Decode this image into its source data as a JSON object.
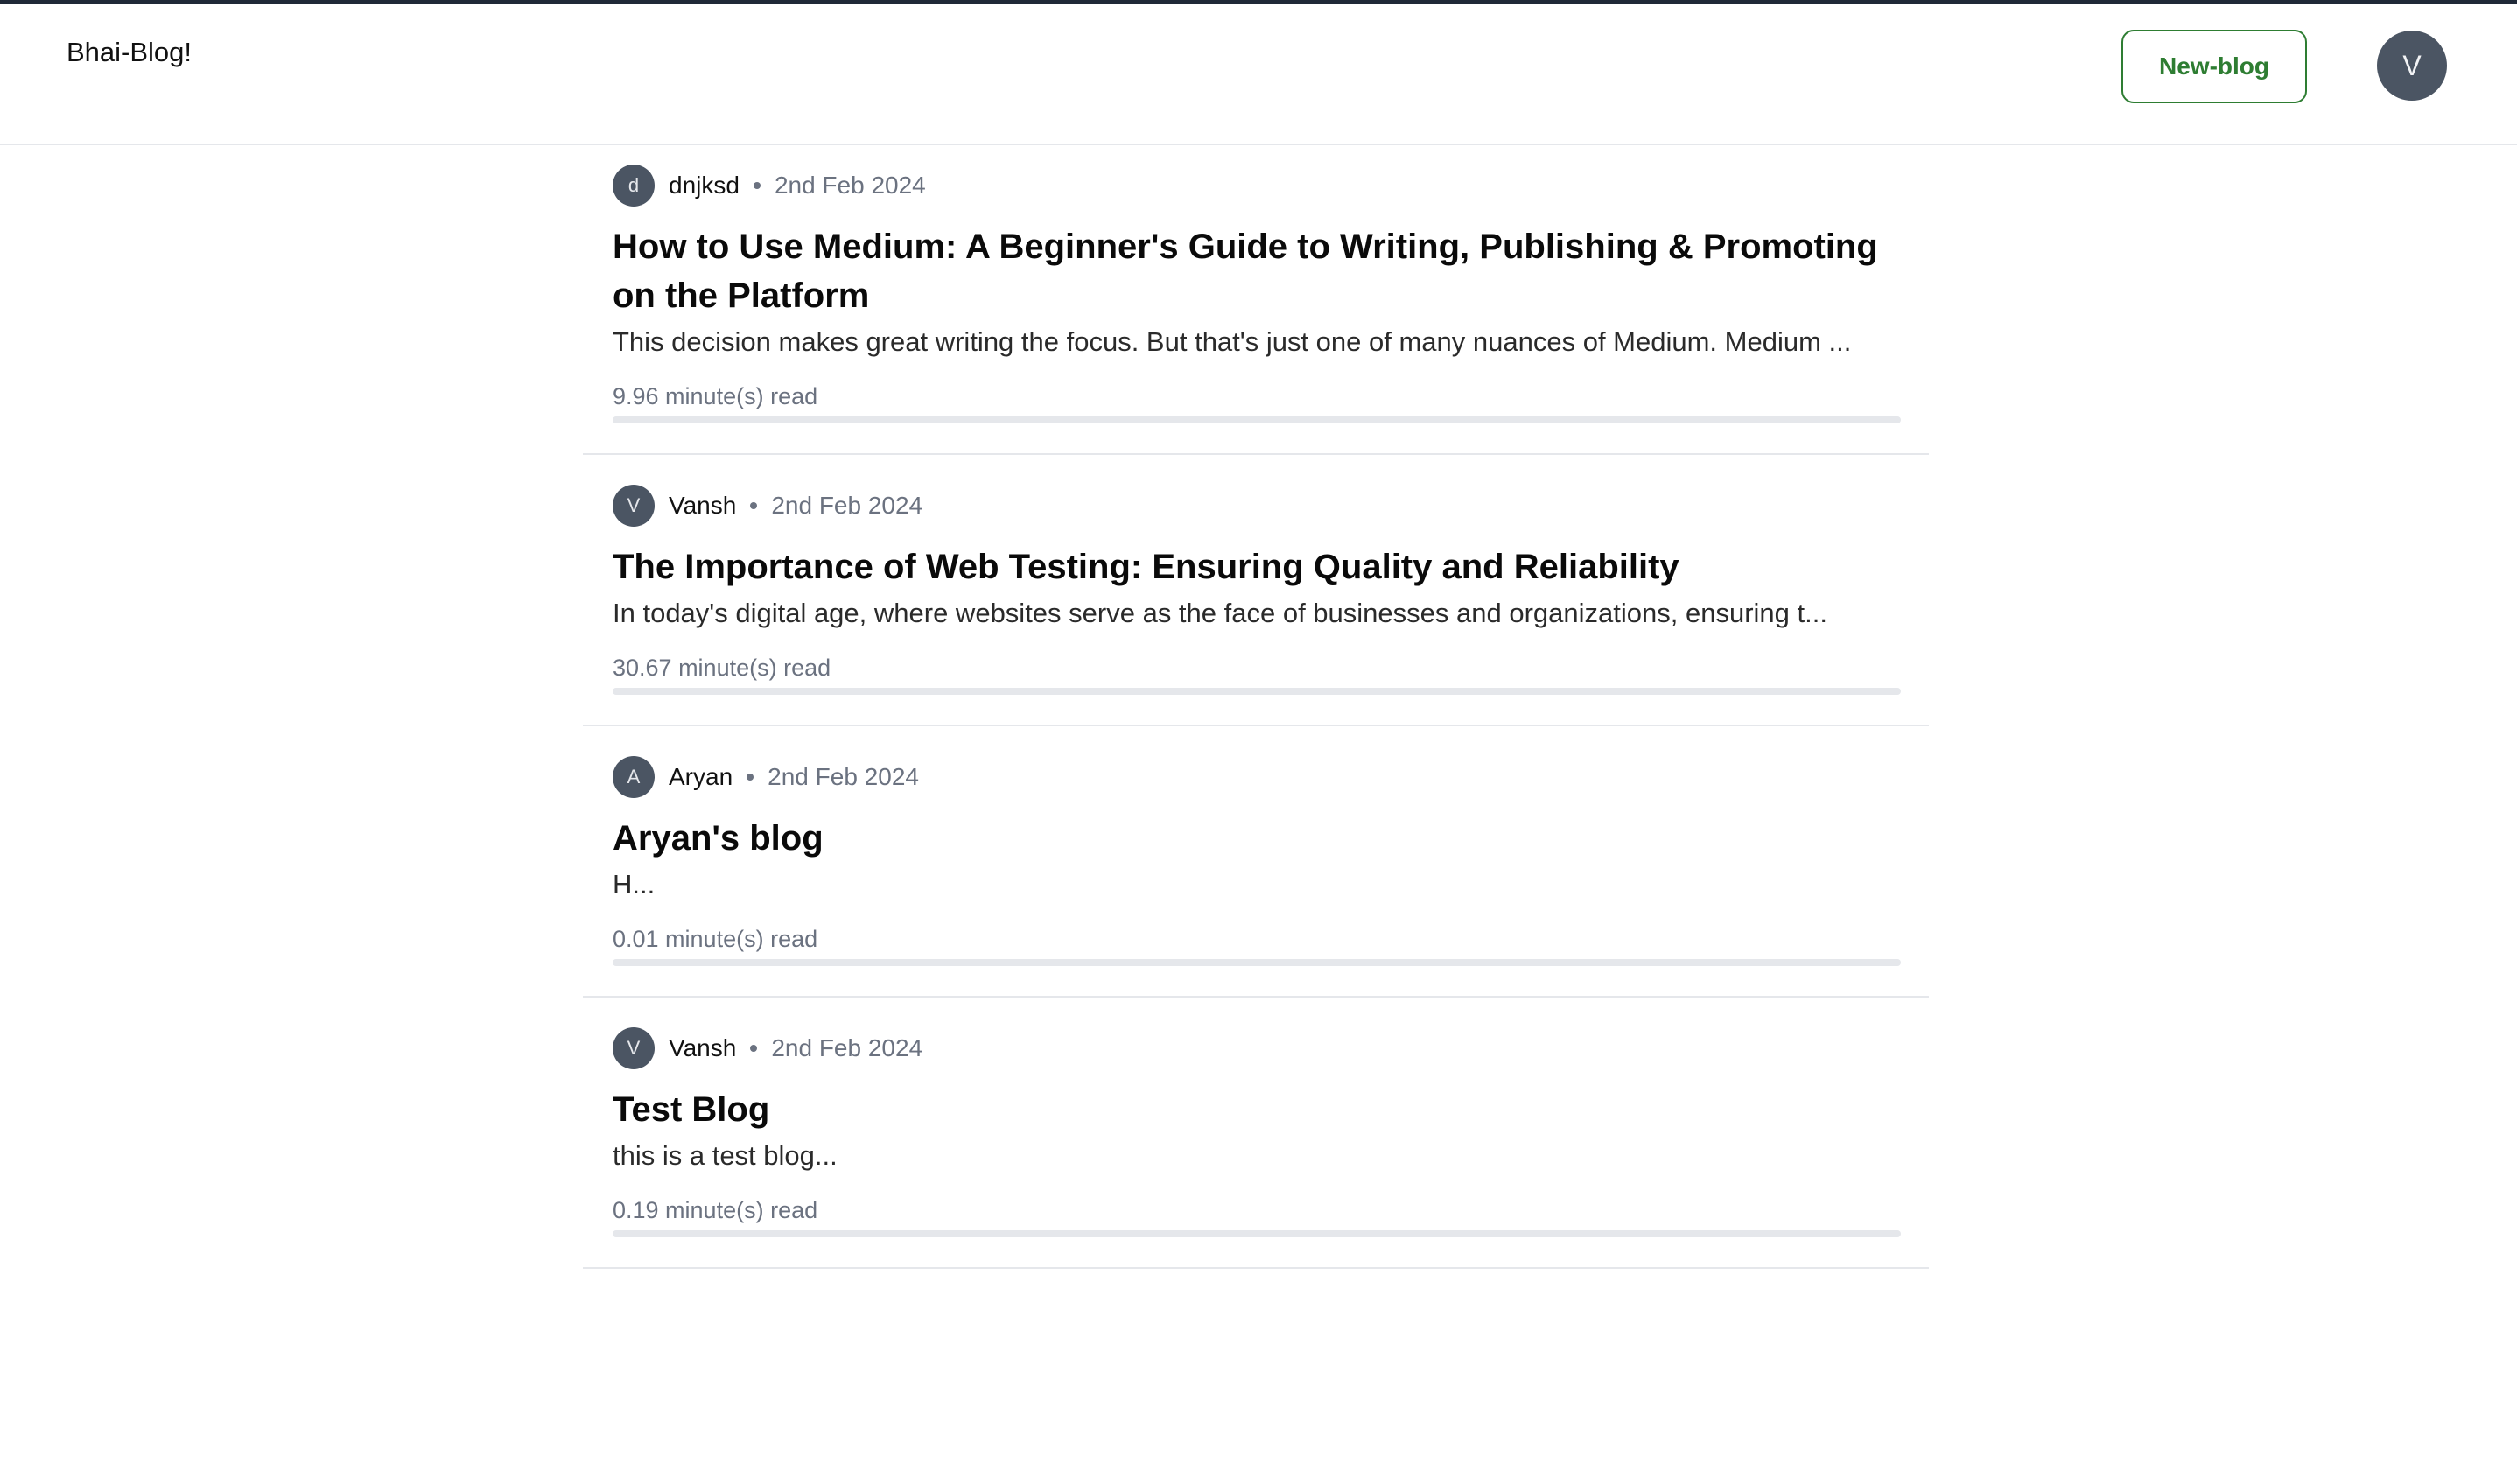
{
  "header": {
    "brand": "Bhai-Blog!",
    "new_blog_label": "New-blog",
    "user_initial": "V"
  },
  "colors": {
    "accent_green": "#2e7d32",
    "avatar_bg": "#4b5563",
    "muted_text": "#6b7280",
    "divider": "#e5e7eb"
  },
  "posts": [
    {
      "author_initial": "d",
      "author": "dnjksd",
      "date": "2nd Feb 2024",
      "title": "How to Use Medium: A Beginner's Guide to Writing, Publishing & Promoting on the Platform",
      "excerpt": "This decision makes great writing the focus. But that's just one of many nuances of Medium. Medium ...",
      "read_time": "9.96 minute(s) read"
    },
    {
      "author_initial": "V",
      "author": "Vansh",
      "date": "2nd Feb 2024",
      "title": "The Importance of Web Testing: Ensuring Quality and Reliability",
      "excerpt": "In today's digital age, where websites serve as the face of businesses and organizations, ensuring t...",
      "read_time": "30.67 minute(s) read"
    },
    {
      "author_initial": "A",
      "author": "Aryan",
      "date": "2nd Feb 2024",
      "title": "Aryan's blog",
      "excerpt": "H...",
      "read_time": "0.01 minute(s) read"
    },
    {
      "author_initial": "V",
      "author": "Vansh",
      "date": "2nd Feb 2024",
      "title": "Test Blog",
      "excerpt": "this is a test blog...",
      "read_time": "0.19 minute(s) read"
    }
  ]
}
